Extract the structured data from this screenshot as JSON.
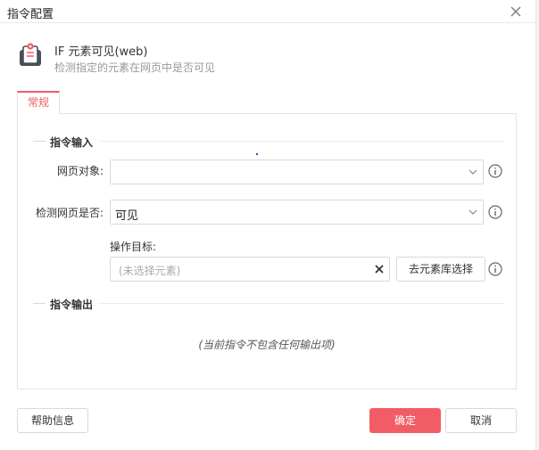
{
  "window": {
    "title": "指令配置"
  },
  "command": {
    "title": "IF 元素可见(web)",
    "description": "检测指定的元素在网页中是否可见"
  },
  "tabs": [
    {
      "label": "常规",
      "active": true
    }
  ],
  "input_section": {
    "title": "指令输入",
    "fields": {
      "web_object": {
        "label": "网页对象:",
        "value": ""
      },
      "check_visible": {
        "label": "检测网页是否:",
        "value": "可见"
      },
      "target": {
        "label": "操作目标:",
        "placeholder": "(未选择元素)",
        "button": "去元素库选择"
      }
    }
  },
  "output_section": {
    "title": "指令输出",
    "empty_text": "(当前指令不包含任何输出项)"
  },
  "footer": {
    "help": "帮助信息",
    "ok": "确定",
    "cancel": "取消"
  },
  "colors": {
    "accent": "#f25c66"
  },
  "icons": [
    "close-icon",
    "command-icon",
    "chevron-down-icon",
    "info-icon",
    "clear-icon"
  ]
}
